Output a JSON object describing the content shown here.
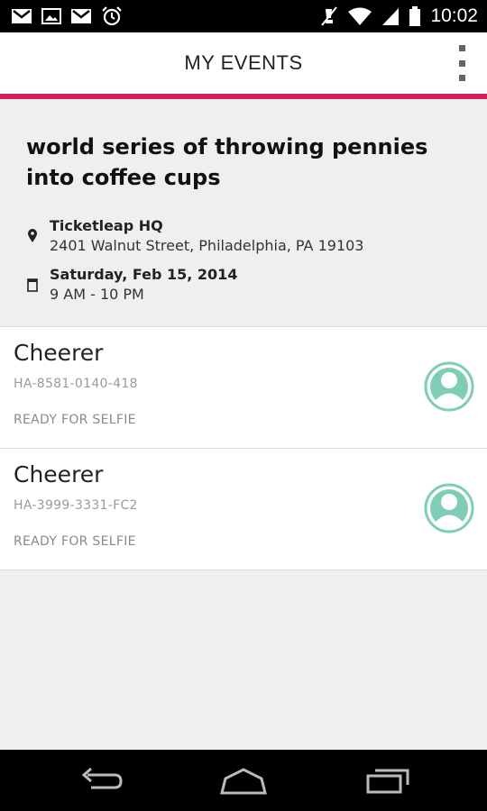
{
  "status_bar": {
    "time": "10:02",
    "icons": [
      "gmail-icon",
      "image-icon",
      "gmail-icon",
      "alarm-icon",
      "mute-icon",
      "wifi-icon",
      "signal-icon",
      "battery-icon"
    ]
  },
  "action_bar": {
    "title": "MY EVENTS",
    "overflow_icon": "overflow-menu-icon"
  },
  "event": {
    "title": "world series of throwing pennies into coffee cups",
    "venue_name": "Ticketleap HQ",
    "venue_address": "2401 Walnut Street, Philadelphia, PA 19103",
    "date": "Saturday, Feb 15, 2014",
    "time_range": "9 AM - 10 PM"
  },
  "tickets": [
    {
      "name": "Cheerer",
      "code": "HA-8581-0140-418",
      "status": "READY FOR SELFIE"
    },
    {
      "name": "Cheerer",
      "code": "HA-3999-3331-FC2",
      "status": "READY FOR SELFIE"
    }
  ],
  "colors": {
    "accent": "#d81b60",
    "avatar": "#7fcdb7"
  },
  "nav_bar": {
    "icons": [
      "back-icon",
      "home-icon",
      "recents-icon"
    ]
  }
}
